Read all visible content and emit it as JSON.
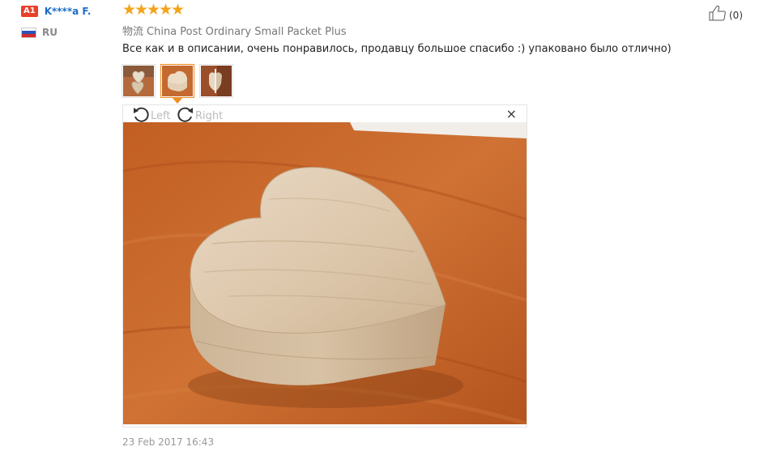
{
  "user": {
    "level_badge": "A1",
    "name": "K****a F.",
    "country_code": "RU",
    "flag_icon": "russia-flag-icon"
  },
  "review": {
    "rating": 5,
    "max_rating": 5,
    "logistics_label": "物流",
    "logistics_value": "China Post Ordinary Small Packet Plus",
    "text": "Все как и в описании, очень понравилось, продавцу большое спасибо :) упаковано было отлично)",
    "date": "23 Feb 2017 16:43",
    "like_count": "(0)",
    "like_icon": "thumbs-up-icon"
  },
  "thumbnails": [
    {
      "name": "photo-thumb-1",
      "active": false
    },
    {
      "name": "photo-thumb-2",
      "active": true
    },
    {
      "name": "photo-thumb-3",
      "active": false
    }
  ],
  "viewer": {
    "rotate_left_label": "Left",
    "rotate_right_label": "Right",
    "close_glyph": "×"
  },
  "colors": {
    "accent_orange": "#f08b1e",
    "star_color": "#f2a41b",
    "username_blue": "#1e6dc6",
    "badge_red": "#e8402a",
    "table_wood": "#c8642a",
    "heart_box_wood": "#d9c3a8"
  }
}
